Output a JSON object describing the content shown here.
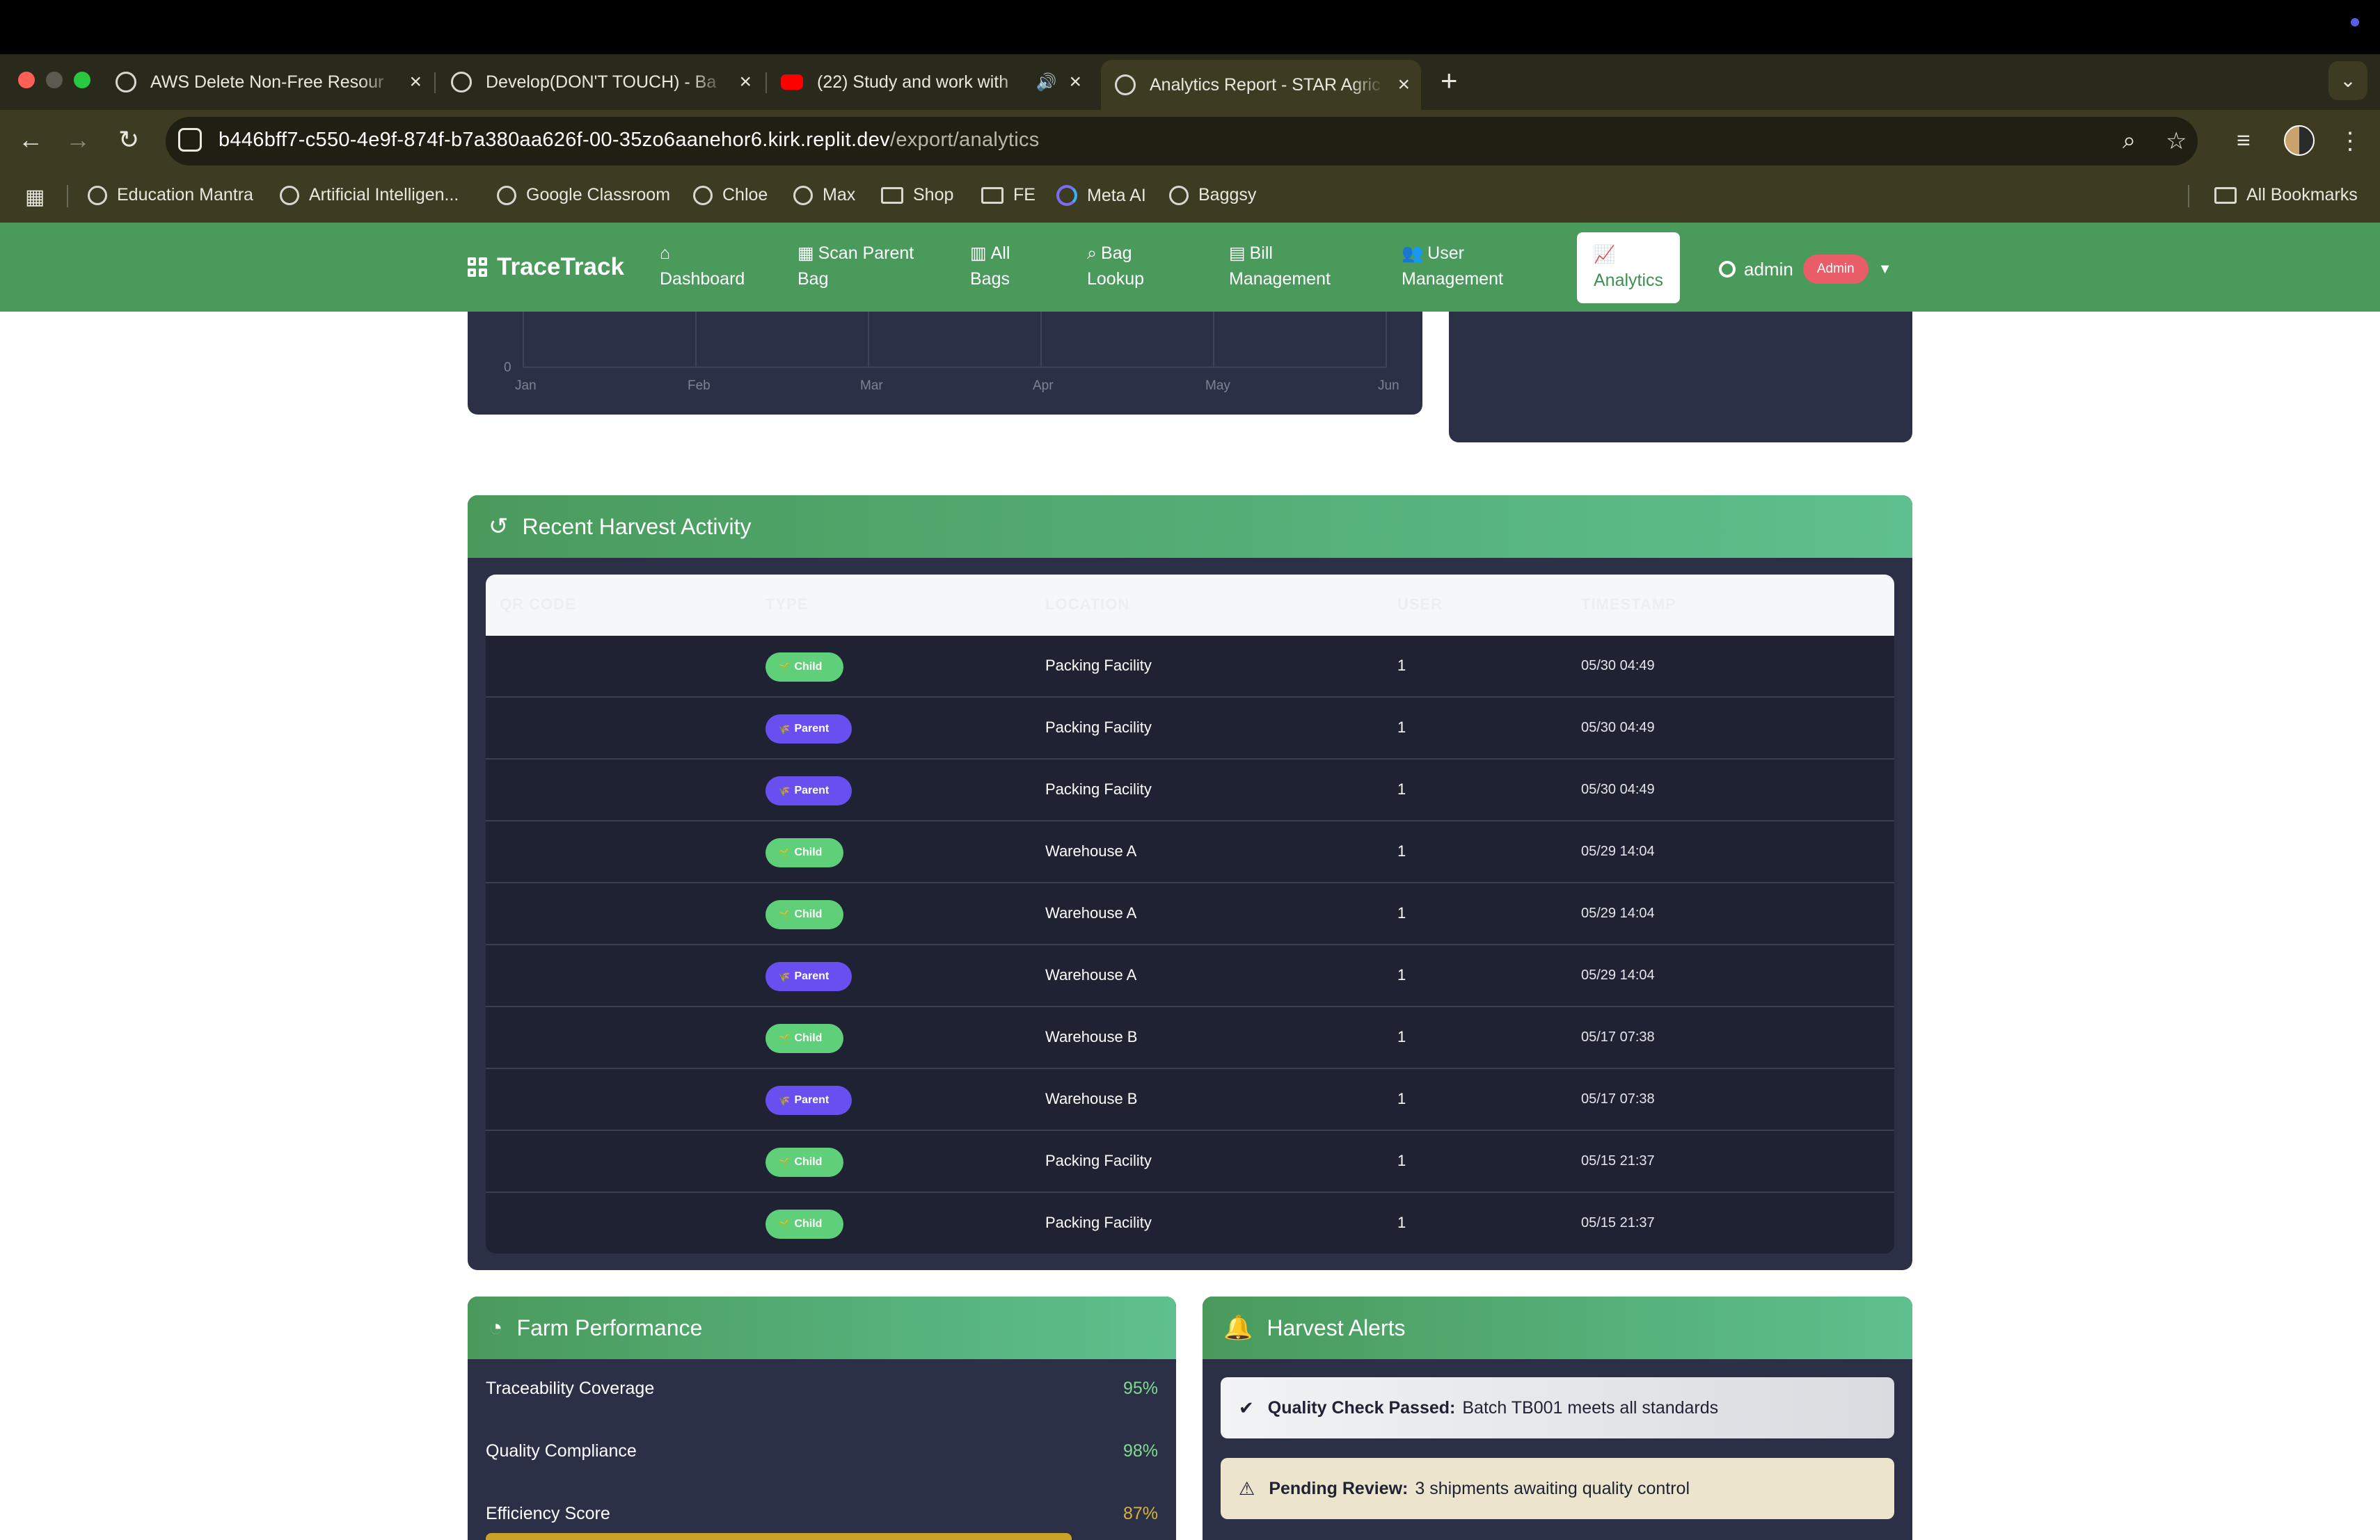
{
  "browser": {
    "tabs": [
      {
        "title": "AWS Delete Non-Free Resour"
      },
      {
        "title": "Develop(DON'T TOUCH) - Ba"
      },
      {
        "title": "(22) Study and work with"
      },
      {
        "title": "Analytics Report - STAR Agric"
      }
    ],
    "new_tab": "+",
    "url_host": "b446bff7-c550-4e9f-874f-b7a380aa626f-00-35zo6aanehor6.kirk.replit.dev",
    "url_path": "/export/analytics",
    "bookmarks": [
      {
        "label": "Education Mantra",
        "icon": "globe-icon"
      },
      {
        "label": "Artificial Intelligen...",
        "icon": "globe-icon"
      },
      {
        "label": "Google Classroom",
        "icon": "globe-icon"
      },
      {
        "label": "Chloe",
        "icon": "globe-icon"
      },
      {
        "label": "Max",
        "icon": "globe-icon"
      },
      {
        "label": "Shop",
        "icon": "folder-icon"
      },
      {
        "label": "FE",
        "icon": "folder-icon"
      },
      {
        "label": "Meta AI",
        "icon": "meta-ai-icon"
      },
      {
        "label": "Baggsy",
        "icon": "globe-icon"
      }
    ],
    "all_bookmarks": "All Bookmarks"
  },
  "nav": {
    "brand": "TraceTrack",
    "items": [
      {
        "line1": "Dashboard",
        "line2": "",
        "icon": "home-icon"
      },
      {
        "line1": "Scan Parent",
        "line2": "Bag",
        "icon": "qrcode-icon"
      },
      {
        "line1": "All",
        "line2": "Bags",
        "icon": "boxes-icon"
      },
      {
        "line1": "Bag",
        "line2": "Lookup",
        "icon": "search-icon"
      },
      {
        "line1": "Bill",
        "line2": "Management",
        "icon": "file-icon"
      },
      {
        "line1": "User",
        "line2": "Management",
        "icon": "users-icon"
      },
      {
        "line1": "",
        "line2": "Analytics",
        "icon": "chart-icon"
      }
    ],
    "user": "admin",
    "role_badge": "Admin"
  },
  "chart_data": {
    "type": "line",
    "categories": [
      "Jan",
      "Feb",
      "Mar",
      "Apr",
      "May",
      "Jun"
    ],
    "y_ticks": [
      "0"
    ],
    "grid": true
  },
  "activity": {
    "title": "Recent Harvest Activity",
    "columns": [
      "QR CODE",
      "TYPE",
      "LOCATION",
      "USER",
      "TIMESTAMP"
    ],
    "rows": [
      {
        "qr": "",
        "type": "Child",
        "location": "Packing Facility",
        "user": "1",
        "timestamp": "05/30 04:49"
      },
      {
        "qr": "",
        "type": "Parent",
        "location": "Packing Facility",
        "user": "1",
        "timestamp": "05/30 04:49"
      },
      {
        "qr": "",
        "type": "Parent",
        "location": "Packing Facility",
        "user": "1",
        "timestamp": "05/30 04:49"
      },
      {
        "qr": "",
        "type": "Child",
        "location": "Warehouse A",
        "user": "1",
        "timestamp": "05/29 14:04"
      },
      {
        "qr": "",
        "type": "Child",
        "location": "Warehouse A",
        "user": "1",
        "timestamp": "05/29 14:04"
      },
      {
        "qr": "",
        "type": "Parent",
        "location": "Warehouse A",
        "user": "1",
        "timestamp": "05/29 14:04"
      },
      {
        "qr": "",
        "type": "Child",
        "location": "Warehouse B",
        "user": "1",
        "timestamp": "05/17 07:38"
      },
      {
        "qr": "",
        "type": "Parent",
        "location": "Warehouse B",
        "user": "1",
        "timestamp": "05/17 07:38"
      },
      {
        "qr": "",
        "type": "Child",
        "location": "Packing Facility",
        "user": "1",
        "timestamp": "05/15 21:37"
      },
      {
        "qr": "",
        "type": "Child",
        "location": "Packing Facility",
        "user": "1",
        "timestamp": "05/15 21:37"
      }
    ]
  },
  "performance": {
    "title": "Farm Performance",
    "metrics": [
      {
        "label": "Traceability Coverage",
        "value": "95%",
        "color": "#7ddc8f"
      },
      {
        "label": "Quality Compliance",
        "value": "98%",
        "color": "#7ddc8f"
      },
      {
        "label": "Efficiency Score",
        "value": "87%",
        "color": "#d9b13a"
      }
    ]
  },
  "alerts": {
    "title": "Harvest Alerts",
    "items": [
      {
        "strong": "Quality Check Passed:",
        "text": "Batch TB001 meets all standards",
        "kind": "success",
        "icon": "check-circle-icon"
      },
      {
        "strong": "Pending Review:",
        "text": "3 shipments awaiting quality control",
        "kind": "warning",
        "icon": "warning-icon"
      }
    ]
  },
  "colors": {
    "nav_green": "#4a9a5c",
    "child_pill": "#5fcf7a",
    "parent_pill": "#6a4ff0",
    "admin_badge": "#e85d67",
    "card_bg": "#2b3046"
  }
}
